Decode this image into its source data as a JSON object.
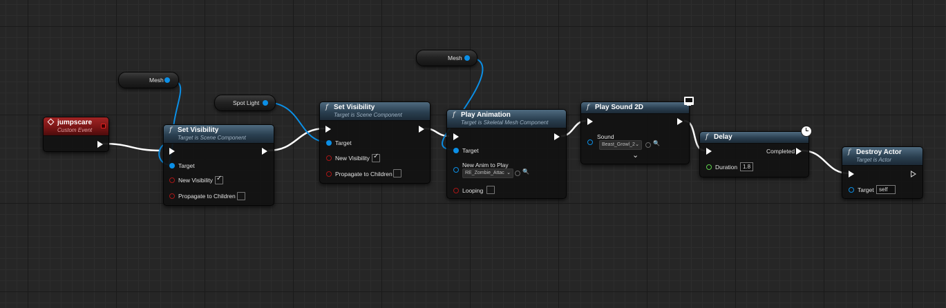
{
  "graph": {
    "event_node": {
      "title": "jumpscare",
      "subtitle": "Custom Event"
    },
    "set_visibility_1": {
      "fn_icon": "f",
      "title": "Set Visibility",
      "subtitle": "Target is Scene Component",
      "pins": {
        "target": "Target",
        "new_visibility": "New Visibility",
        "propagate": "Propagate to Children"
      },
      "new_visibility_checked": true,
      "propagate_checked": false
    },
    "set_visibility_2": {
      "fn_icon": "f",
      "title": "Set Visibility",
      "subtitle": "Target is Scene Component",
      "pins": {
        "target": "Target",
        "new_visibility": "New Visibility",
        "propagate": "Propagate to Children"
      },
      "new_visibility_checked": true,
      "propagate_checked": false
    },
    "play_animation": {
      "fn_icon": "f",
      "title": "Play Animation",
      "subtitle": "Target is Skeletal Mesh Component",
      "pins": {
        "target": "Target",
        "new_anim": "New Anim to Play",
        "looping": "Looping"
      },
      "new_anim_value": "RE_Zombie_Attac",
      "looping_checked": false
    },
    "play_sound_2d": {
      "fn_icon": "f",
      "title": "Play Sound 2D",
      "pins": {
        "sound": "Sound"
      },
      "sound_value": "Beast_Growl_2"
    },
    "delay": {
      "fn_icon": "f",
      "title": "Delay",
      "pins": {
        "completed": "Completed",
        "duration": "Duration"
      },
      "duration_value": "1.8"
    },
    "destroy_actor": {
      "fn_icon": "f",
      "title": "Destroy Actor",
      "subtitle": "Target is Actor",
      "pins": {
        "target": "Target"
      },
      "target_value": "self"
    },
    "variables": {
      "mesh_1": "Mesh",
      "spot_light": "Spot Light",
      "mesh_2": "Mesh"
    },
    "icons": {
      "check": "✓",
      "chevron": "⌄",
      "magnifier": "🔍",
      "expand": "⌄"
    },
    "colors": {
      "exec_wire": "#ffffff",
      "object_wire": "#0b8fe6",
      "event_header": "#8b1a1a",
      "function_header": "#2f4a5e",
      "bool_pin": "#a81616",
      "float_pin": "#5fd14c"
    }
  }
}
